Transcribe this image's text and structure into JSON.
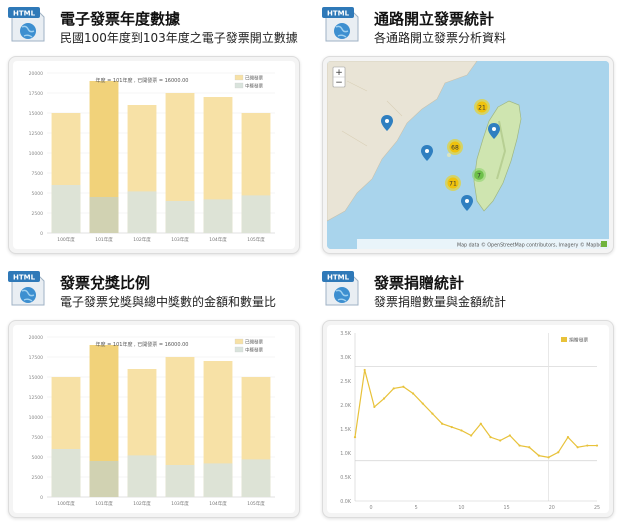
{
  "panels": [
    {
      "title": "電子發票年度數據",
      "subtitle": "民國100年度到103年度之電子發票開立數據",
      "icon": "html-globe-icon",
      "chart_data": {
        "type": "bar",
        "categories": [
          "100年度",
          "101年度",
          "102年度",
          "103年度",
          "104年度",
          "105年度"
        ],
        "series": [
          {
            "name": "已開發票",
            "values": [
              15000,
              19000,
              16000,
              17500,
              17000,
              15000
            ],
            "color": "#f7e1a6"
          },
          {
            "name": "中獎發票",
            "values": [
              6000,
              4500,
              5200,
              4000,
              4200,
              4700
            ],
            "color": "#d9e3dc"
          }
        ],
        "highlight_index": 1,
        "tooltip": "年度 = 101年度 , 已開發票 = 16000.00",
        "ylim": [
          0,
          20000
        ],
        "yticks": [
          "0",
          "2500",
          "5000",
          "7500",
          "10000",
          "12500",
          "15000",
          "17500",
          "20000"
        ]
      }
    },
    {
      "title": "通路開立發票統計",
      "subtitle": "各通路開立發票分析資料",
      "icon": "html-globe-icon",
      "map": {
        "zoom_in": "+",
        "zoom_out": "−",
        "cluster_labels": [
          "21",
          "68",
          "71",
          "7"
        ],
        "attribution": "Map data © OpenStreetMap contributors, Imagery © Mapbox"
      }
    },
    {
      "title": "發票兌獎比例",
      "subtitle": "電子發票兌獎與總中獎數的金額和數量比",
      "icon": "html-globe-icon",
      "chart_data": {
        "type": "bar",
        "categories": [
          "100年度",
          "101年度",
          "102年度",
          "103年度",
          "104年度",
          "105年度"
        ],
        "series": [
          {
            "name": "已開發票",
            "values": [
              15000,
              19000,
              16000,
              17500,
              17000,
              15000
            ],
            "color": "#f7e1a6"
          },
          {
            "name": "中獎發票",
            "values": [
              6000,
              4500,
              5200,
              4000,
              4200,
              4700
            ],
            "color": "#d9e3dc"
          }
        ],
        "highlight_index": 1,
        "tooltip": "年度 = 101年度 , 已開發票 = 16000.00",
        "ylim": [
          0,
          20000
        ],
        "yticks": [
          "0",
          "2500",
          "5000",
          "7500",
          "10000",
          "12500",
          "15000",
          "17500",
          "20000"
        ]
      }
    },
    {
      "title": "發票捐贈統計",
      "subtitle": "發票捐贈數量與金額統計",
      "icon": "html-globe-icon",
      "chart_data": {
        "type": "line",
        "legend": "捐贈發票",
        "ylim": [
          0,
          5
        ],
        "yticks": [
          "0.0K",
          "0.5K",
          "1.0K",
          "1.5K",
          "2.0K",
          "2.5K",
          "3.0K",
          "3.5K"
        ],
        "xticks": [
          "0",
          "5",
          "10",
          "15",
          "20",
          "25"
        ],
        "values": [
          1.9,
          3.9,
          2.8,
          3.05,
          3.35,
          3.4,
          3.2,
          2.9,
          2.6,
          2.3,
          2.2,
          2.1,
          1.95,
          2.3,
          1.9,
          1.8,
          1.95,
          1.65,
          1.6,
          1.35,
          1.3,
          1.45,
          1.9,
          1.6,
          1.65,
          1.65
        ]
      }
    }
  ]
}
